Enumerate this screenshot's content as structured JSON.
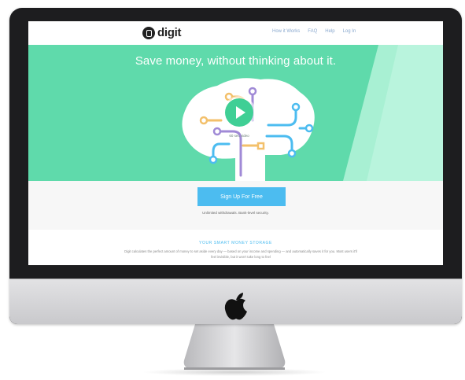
{
  "nav": {
    "logo_text": "digit",
    "links": [
      "How it Works",
      "FAQ",
      "Help",
      "Log In"
    ]
  },
  "hero": {
    "title": "Save money, without thinking about it.",
    "video_length": "60 sec video"
  },
  "cta": {
    "button_label": "Sign Up For Free",
    "subtext": "Unlimited withdrawals. Bank-level security."
  },
  "info": {
    "heading": "YOUR SMART MONEY STORAGE",
    "body": "Digit calculates the perfect amount of money to set aside every day — based on your income and spending — and automatically saves it for you. Most users it'll feel invisible, but it won't take long to feel"
  },
  "colors": {
    "hero_green": "#5fdaab",
    "signup_blue": "#4cbcf0",
    "imac_bezel": "#1d1d1f"
  }
}
